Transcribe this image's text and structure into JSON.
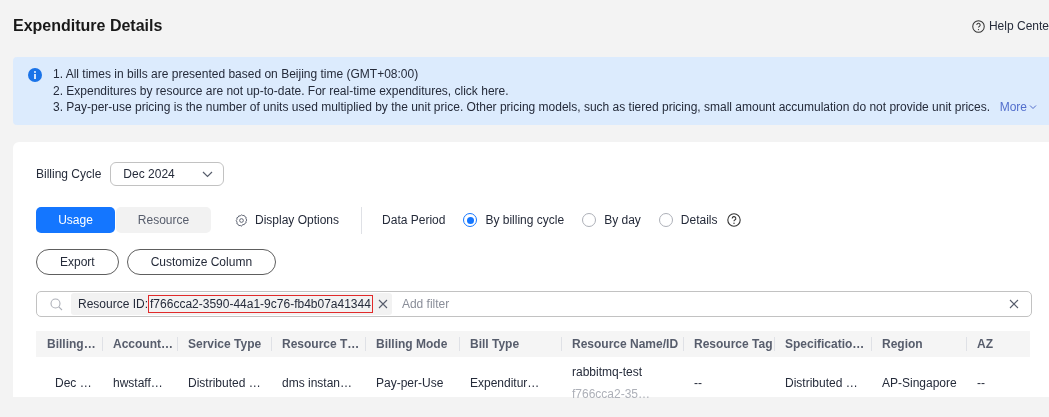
{
  "page": {
    "title": "Expenditure Details",
    "help_link": "Help Cente"
  },
  "notice": {
    "lines": [
      "1. All times in bills are presented based on Beijing time (GMT+08:00)",
      "2. Expenditures by resource are not up-to-date. For real-time expenditures, click here.",
      "3. Pay-per-use pricing is the number of units used multiplied by the unit price. Other pricing models, such as tiered pricing, small amount accumulation do not provide unit prices."
    ],
    "more": "More"
  },
  "billing_cycle": {
    "label": "Billing Cycle",
    "value": "Dec 2024"
  },
  "view_tabs": [
    {
      "label": "Usage",
      "selected": true
    },
    {
      "label": "Resource",
      "selected": false
    }
  ],
  "display_options": "Display Options",
  "data_period": {
    "label": "Data Period",
    "options": [
      {
        "label": "By billing cycle",
        "selected": true
      },
      {
        "label": "By day",
        "selected": false
      },
      {
        "label": "Details",
        "selected": false
      }
    ]
  },
  "actions": [
    "Export",
    "Customize Column"
  ],
  "search": {
    "chips": [
      {
        "key": "Resource ID:",
        "value": "f766cca2-3590-44a1-9c76-fb4b07a41344",
        "highlighted": true
      }
    ],
    "placeholder": "Add filter"
  },
  "table": {
    "columns": [
      "Billing…",
      "Account…",
      "Service Type",
      "Resource T…",
      "Billing Mode",
      "Bill Type",
      "Resource Name/ID",
      "Resource Tag",
      "Specificatio…",
      "Region",
      "AZ"
    ],
    "rows": [
      {
        "cells": [
          {
            "text": "Dec …"
          },
          {
            "text": "hwstaff…"
          },
          {
            "text": "Distributed …"
          },
          {
            "text": "dms instan…"
          },
          {
            "text": "Pay-per-Use"
          },
          {
            "text": "Expenditur…"
          },
          {
            "text": "rabbitmq-test",
            "subtext": "f766cca2-35…"
          },
          {
            "text": "--"
          },
          {
            "text": "Distributed …"
          },
          {
            "text": "AP-Singapore"
          },
          {
            "text": "--"
          }
        ]
      }
    ]
  }
}
